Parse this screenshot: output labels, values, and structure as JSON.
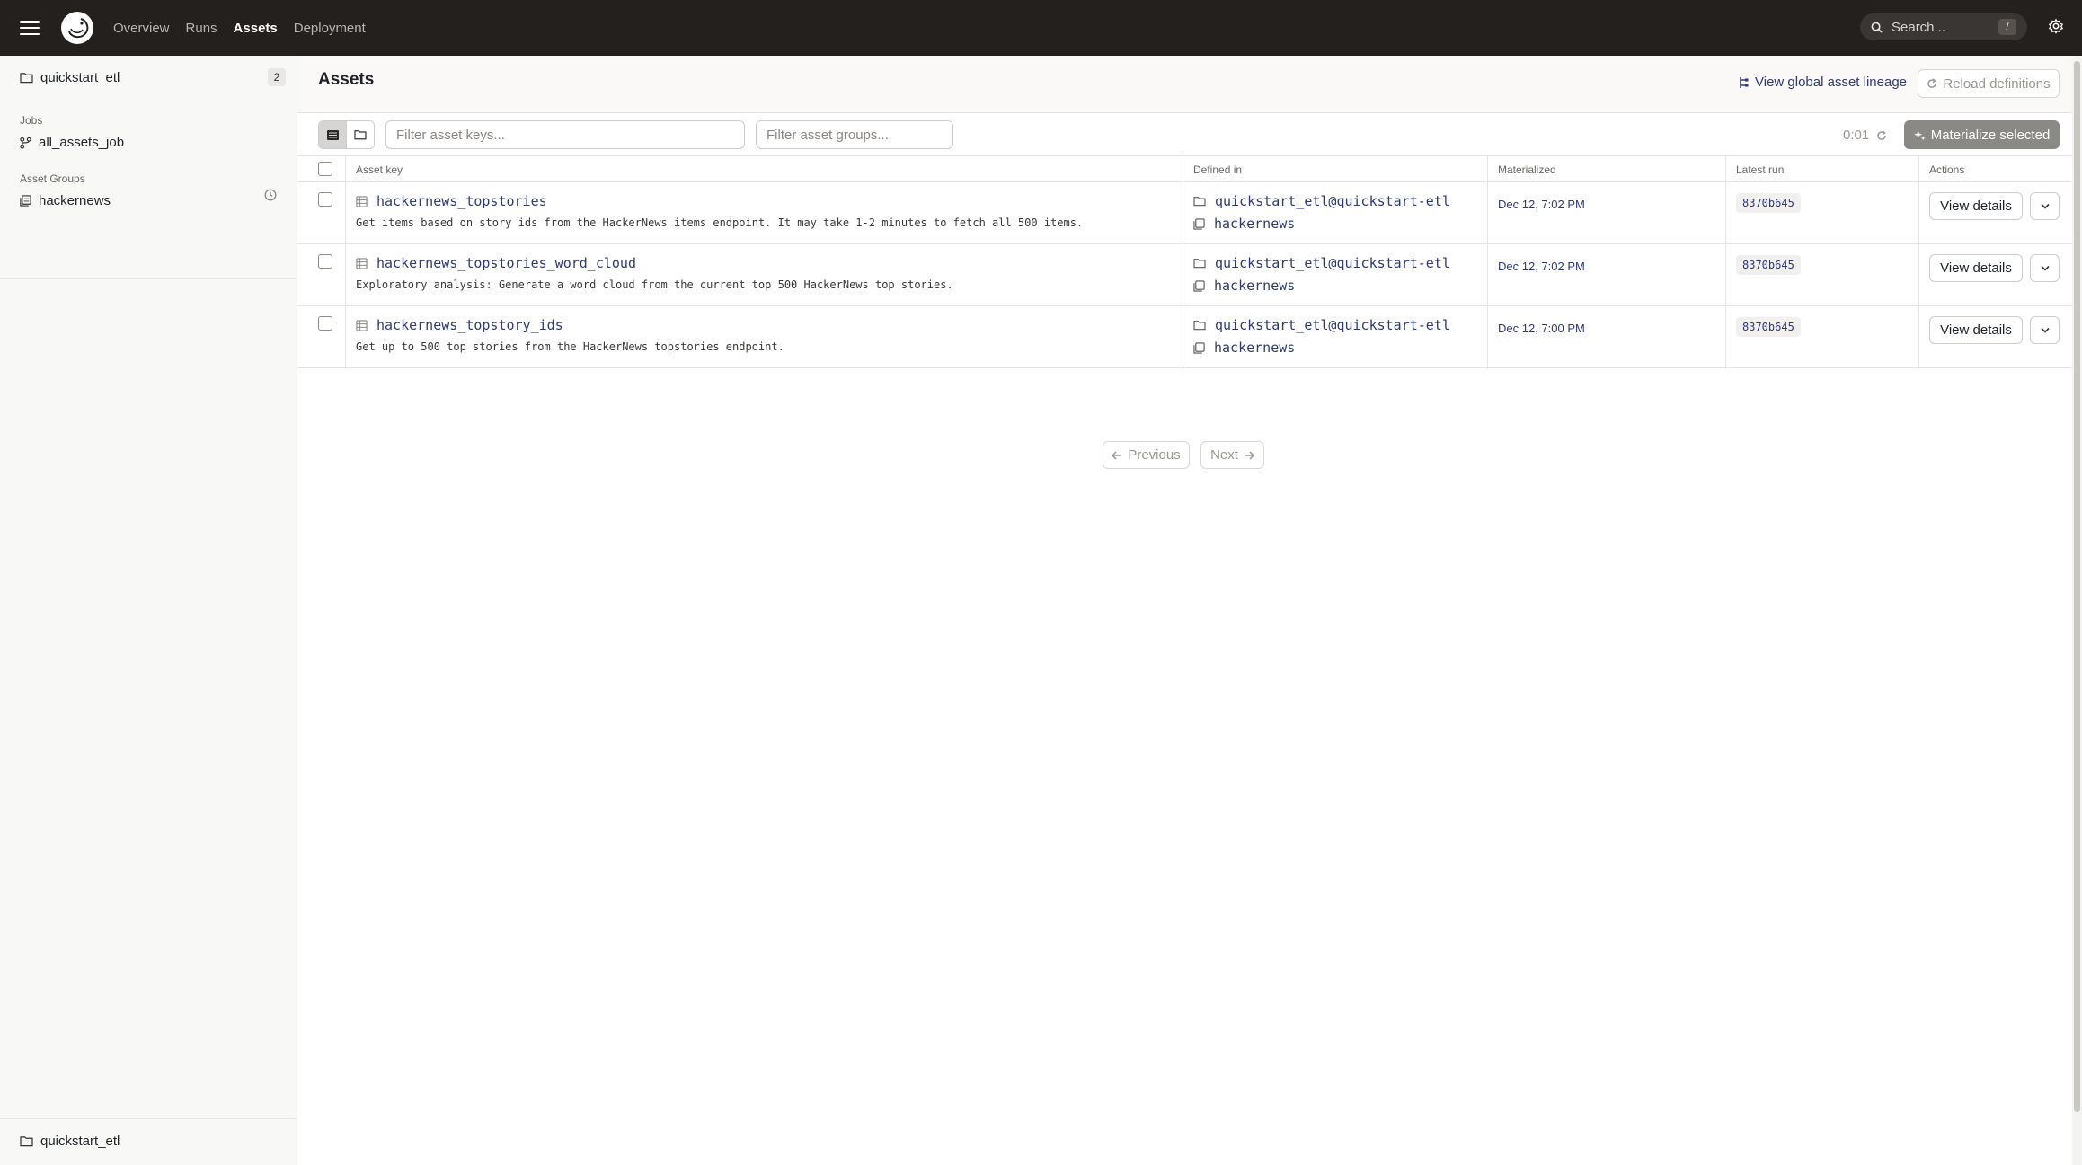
{
  "nav": {
    "items": [
      {
        "label": "Overview"
      },
      {
        "label": "Runs"
      },
      {
        "label": "Assets"
      },
      {
        "label": "Deployment"
      }
    ],
    "active": "Assets",
    "search_placeholder": "Search...",
    "search_shortcut": "/"
  },
  "sidebar": {
    "repo": {
      "name": "quickstart_etl",
      "count": "2"
    },
    "jobs_heading": "Jobs",
    "job": "all_assets_job",
    "groups_heading": "Asset Groups",
    "group": "hackernews",
    "footer_repo": "quickstart_etl"
  },
  "header": {
    "title": "Assets",
    "lineage_link": "View global asset lineage",
    "reload_button": "Reload definitions"
  },
  "toolbar": {
    "filter_keys_placeholder": "Filter asset keys...",
    "filter_groups_placeholder": "Filter asset groups...",
    "timer": "0:01",
    "materialize_button": "Materialize selected"
  },
  "table": {
    "columns": {
      "asset_key": "Asset key",
      "defined_in": "Defined in",
      "materialized": "Materialized",
      "latest_run": "Latest run",
      "actions": "Actions"
    },
    "rows": [
      {
        "key": "hackernews_topstories",
        "description": "Get items based on story ids from the HackerNews items endpoint. It may take 1-2 minutes to fetch all 500 items.",
        "repo": "quickstart_etl@quickstart-etl",
        "group": "hackernews",
        "materialized": "Dec 12, 7:02 PM",
        "run": "8370b645",
        "action": "View details"
      },
      {
        "key": "hackernews_topstories_word_cloud",
        "description": "Exploratory analysis: Generate a word cloud from the current top 500 HackerNews top stories.",
        "repo": "quickstart_etl@quickstart-etl",
        "group": "hackernews",
        "materialized": "Dec 12, 7:02 PM",
        "run": "8370b645",
        "action": "View details"
      },
      {
        "key": "hackernews_topstory_ids",
        "description": "Get up to 500 top stories from the HackerNews topstories endpoint.",
        "repo": "quickstart_etl@quickstart-etl",
        "group": "hackernews",
        "materialized": "Dec 12, 7:00 PM",
        "run": "8370b645",
        "action": "View details"
      }
    ]
  },
  "pagination": {
    "previous": "Previous",
    "next": "Next"
  },
  "colors": {
    "topbar": "#23201e",
    "link": "#2f3a74",
    "materialize_bg": "#8b8986"
  }
}
